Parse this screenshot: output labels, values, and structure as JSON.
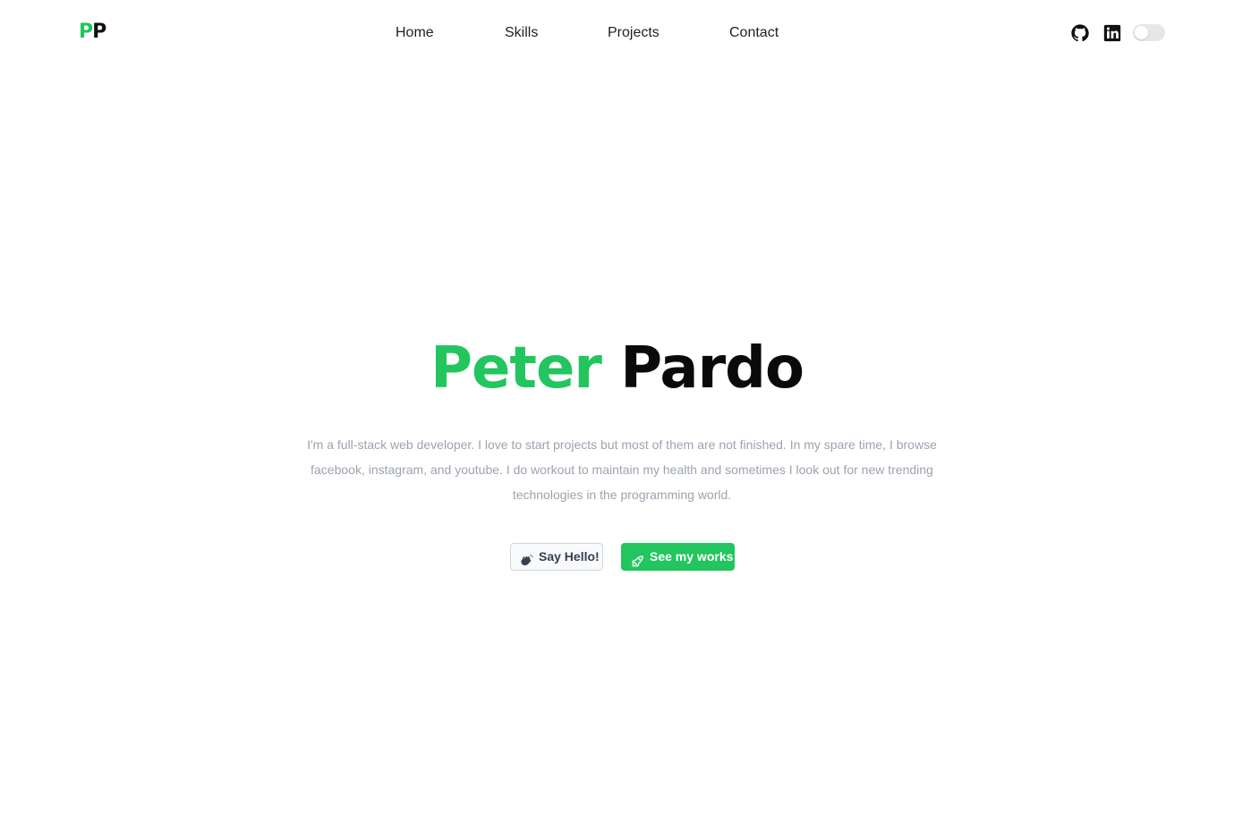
{
  "header": {
    "logo": {
      "first": "P",
      "second": "P"
    },
    "nav": [
      {
        "label": "Home"
      },
      {
        "label": "Skills"
      },
      {
        "label": "Projects"
      },
      {
        "label": "Contact"
      }
    ],
    "icons": [
      "github-icon",
      "linkedin-icon"
    ],
    "theme_toggle": {
      "state": "off"
    }
  },
  "hero": {
    "first_name": "Peter",
    "last_name": "Pardo",
    "description": "I'm a full-stack web developer. I love to start projects but most of them are not finished. In my spare time, I browse facebook, instagram, and youtube. I do workout to maintain my health and sometimes I look out for new trending technologies in the programming world.",
    "buttons": {
      "hello": {
        "label": "Say Hello!",
        "icon": "clapping-hands-icon"
      },
      "works": {
        "label": "See my works",
        "icon": "rocket-icon"
      }
    }
  },
  "colors": {
    "accent": "#22c55e",
    "text": "#0a0a0a",
    "muted": "#9ca3af"
  }
}
